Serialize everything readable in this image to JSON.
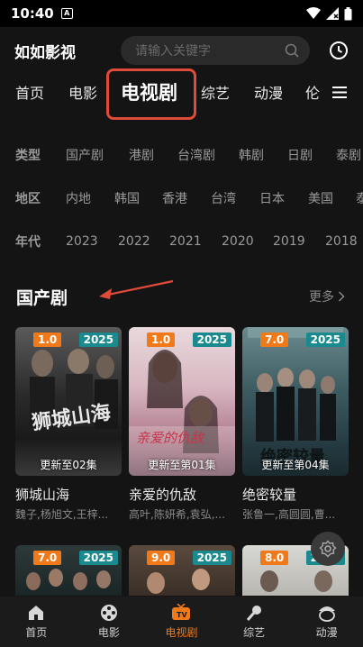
{
  "status": {
    "time": "10:40",
    "sim_label": "A"
  },
  "app": {
    "title": "如如影视",
    "search_placeholder": "请输入关键字"
  },
  "tabs": [
    {
      "label": "首页"
    },
    {
      "label": "电影"
    },
    {
      "label": "电视剧",
      "active": true
    },
    {
      "label": "综艺"
    },
    {
      "label": "动漫"
    },
    {
      "label": "伦"
    }
  ],
  "filters": {
    "type": {
      "label": "类型",
      "options": [
        "国产剧",
        "港剧",
        "台湾剧",
        "韩剧",
        "日剧",
        "泰剧"
      ]
    },
    "region": {
      "label": "地区",
      "options": [
        "内地",
        "韩国",
        "香港",
        "台湾",
        "日本",
        "美国",
        "泰"
      ]
    },
    "year": {
      "label": "年代",
      "options": [
        "2023",
        "2022",
        "2021",
        "2020",
        "2019",
        "2018"
      ]
    }
  },
  "section": {
    "title": "国产剧",
    "more_label": "更多"
  },
  "cards": [
    {
      "score": "1.0",
      "year": "2025",
      "episode": "更新至02集",
      "title": "狮城山海",
      "cast": "魏子,杨旭文,王梓..."
    },
    {
      "score": "1.0",
      "year": "2025",
      "episode": "更新至第01集",
      "title": "亲爱的仇敌",
      "cast": "高叶,陈妍希,袁弘,..."
    },
    {
      "score": "7.0",
      "year": "2025",
      "episode": "更新至第04集",
      "title": "绝密较量",
      "cast": "张鲁一,高圆圆,曹..."
    }
  ],
  "cards_row2": [
    {
      "score": "7.0",
      "year": "2025"
    },
    {
      "score": "9.0",
      "year": "2025"
    },
    {
      "score": "8.0",
      "year": "2025"
    }
  ],
  "bottom_nav": [
    {
      "label": "首页",
      "icon": "home-icon"
    },
    {
      "label": "电影",
      "icon": "film-reel-icon"
    },
    {
      "label": "电视剧",
      "icon": "tv-icon",
      "active": true
    },
    {
      "label": "综艺",
      "icon": "microphone-icon"
    },
    {
      "label": "动漫",
      "icon": "anime-icon"
    }
  ],
  "colors": {
    "accent": "#f07a1a",
    "year_badge": "#1b8a8e",
    "annotation": "#e04a3a",
    "background": "#141414"
  }
}
